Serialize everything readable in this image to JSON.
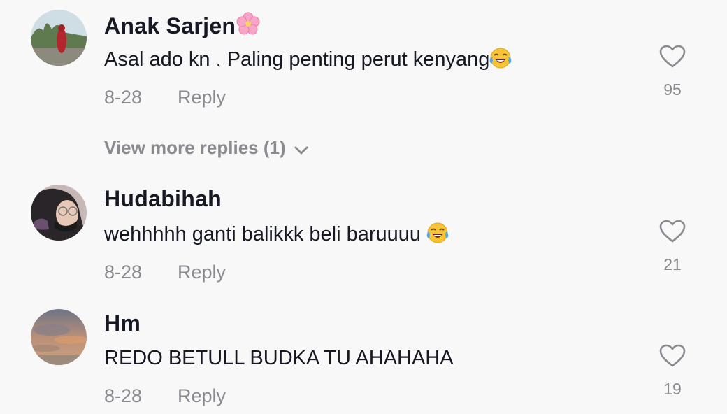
{
  "comments": [
    {
      "username": "Anak Sarjen",
      "username_emoji": "cherry-blossom",
      "text": "Asal ado kn . Paling penting perut kenyang",
      "text_emoji": "face-with-tears-of-joy",
      "date": "8-28",
      "reply_label": "Reply",
      "likes": "95"
    },
    {
      "username": "Hudabihah",
      "text": "wehhhhh ganti balikkk beli baruuuu ",
      "text_emoji": "face-with-tears-of-joy",
      "date": "8-28",
      "reply_label": "Reply",
      "likes": "21"
    },
    {
      "username": "Hm",
      "text": "REDO BETULL BUDKA TU AHAHAHA",
      "date": "8-28",
      "reply_label": "Reply",
      "likes": "19"
    }
  ],
  "view_more_replies": "View more replies (1)",
  "colors": {
    "background": "#f8f8f8",
    "primary_text": "#161823",
    "secondary_text": "#8a8b91"
  }
}
